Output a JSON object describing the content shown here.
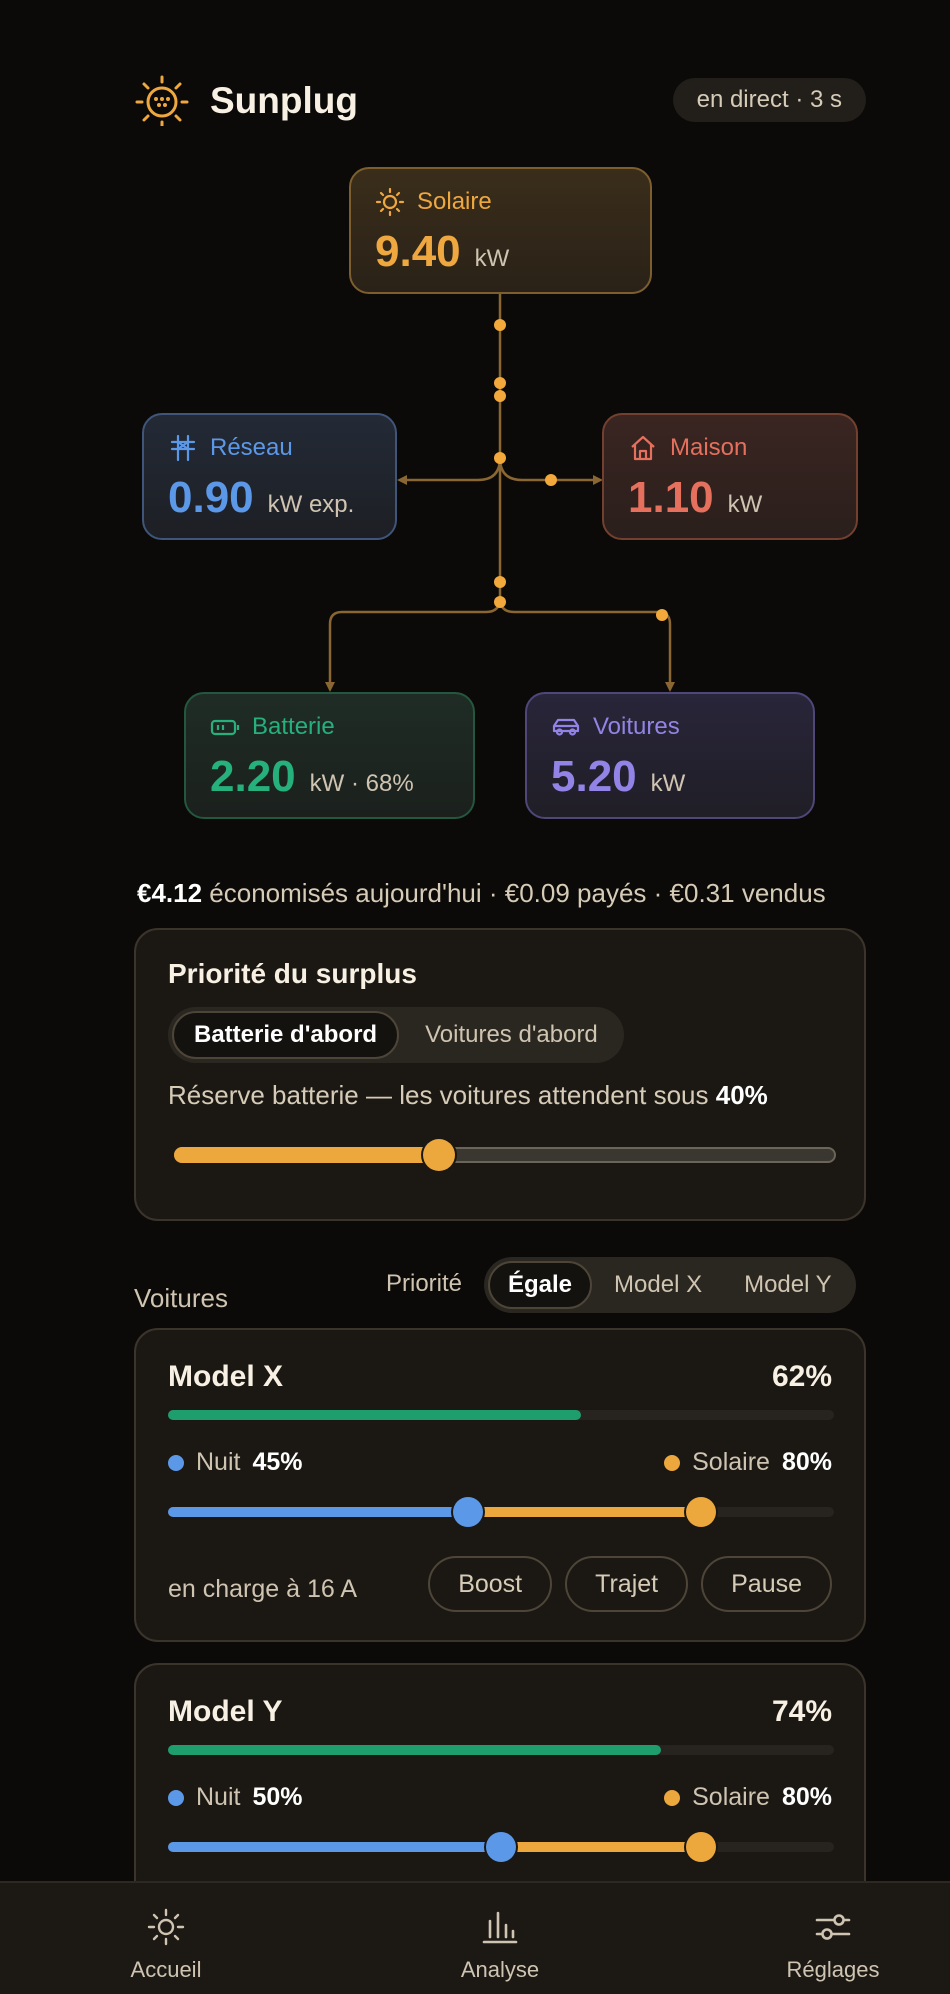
{
  "app": {
    "title": "Sunplug",
    "live_status": "en direct · 3 s"
  },
  "flow": {
    "solar": {
      "label": "Solaire",
      "value": "9.40",
      "unit": "kW"
    },
    "grid": {
      "label": "Réseau",
      "value": "0.90",
      "unit": "kW exp."
    },
    "house": {
      "label": "Maison",
      "value": "1.10",
      "unit": "kW"
    },
    "battery": {
      "label": "Batterie",
      "value": "2.20",
      "unit": "kW · 68%"
    },
    "cars": {
      "label": "Voitures",
      "value": "5.20",
      "unit": "kW"
    }
  },
  "savings": {
    "amount": "€4.12",
    "text": " économisés aujourd'hui · €0.09 payés · €0.31 vendus"
  },
  "priority": {
    "title": "Priorité du surplus",
    "options": [
      "Batterie d'abord",
      "Voitures d'abord"
    ],
    "selected": "Batterie d'abord",
    "reserve_text": "Réserve batterie — les voitures attendent sous ",
    "reserve_value": "40%",
    "reserve_fraction": 0.4
  },
  "cars_section": {
    "label": "Voitures",
    "priority_label": "Priorité",
    "options": [
      "Égale",
      "Model X",
      "Model Y"
    ],
    "selected": "Égale"
  },
  "cars": [
    {
      "name": "Model X",
      "charge_pct": "62%",
      "charge_fraction": 0.62,
      "night_label": "Nuit",
      "night_value": "45%",
      "night_fraction": 0.45,
      "solar_label": "Solaire",
      "solar_value": "80%",
      "solar_fraction": 0.8,
      "status": "en charge à 16 A",
      "actions": [
        "Boost",
        "Trajet",
        "Pause"
      ]
    },
    {
      "name": "Model Y",
      "charge_pct": "74%",
      "charge_fraction": 0.74,
      "night_label": "Nuit",
      "night_value": "50%",
      "night_fraction": 0.5,
      "solar_label": "Solaire",
      "solar_value": "80%",
      "solar_fraction": 0.8
    }
  ],
  "nav": {
    "home": "Accueil",
    "analysis": "Analyse",
    "settings": "Réglages"
  },
  "colors": {
    "solar": "#efa73f",
    "grid": "#5c98e8",
    "house": "#e5705d",
    "battery": "#25b07c",
    "cars": "#9284e6",
    "flow_line": "#8a6632",
    "flow_dot": "#f2a83a"
  },
  "icons": {
    "logo": "sun-plug-icon",
    "solar": "sun-icon",
    "grid": "pylon-icon",
    "house": "house-icon",
    "battery": "battery-icon",
    "cars": "car-icon",
    "home": "sun-icon",
    "analysis": "bar-chart-icon",
    "settings": "sliders-icon"
  }
}
